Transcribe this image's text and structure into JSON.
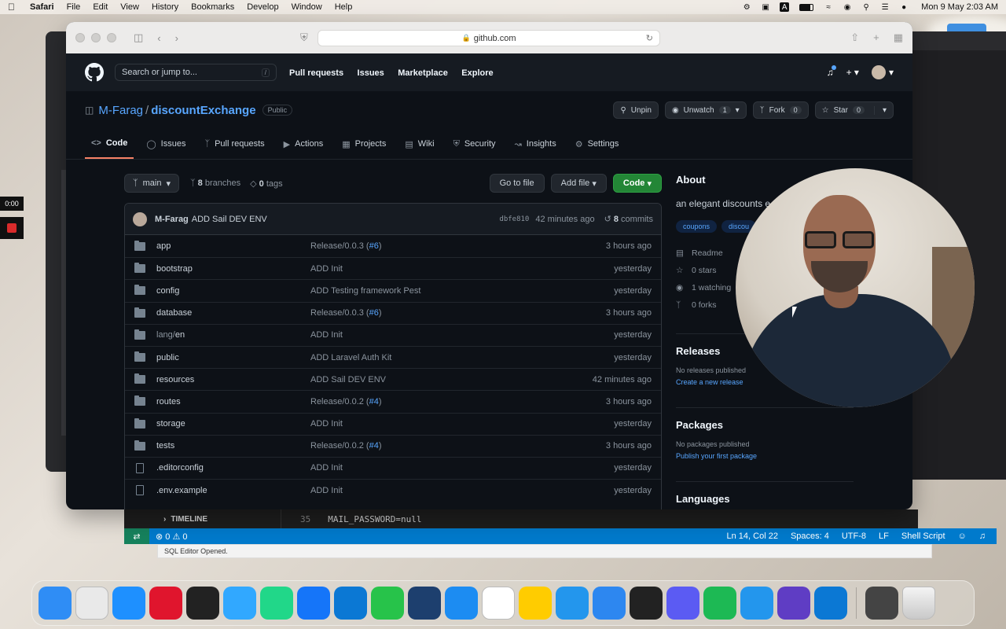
{
  "menubar": {
    "app": "Safari",
    "items": [
      "File",
      "Edit",
      "View",
      "History",
      "Bookmarks",
      "Develop",
      "Window",
      "Help"
    ],
    "datetime": "Mon 9 May  2:03 AM"
  },
  "recorder": {
    "time": "0:00"
  },
  "browser": {
    "url": "github.com"
  },
  "github": {
    "search_placeholder": "Search or jump to...",
    "search_shortcut": "/",
    "nav": [
      "Pull requests",
      "Issues",
      "Marketplace",
      "Explore"
    ],
    "repo": {
      "owner": "M-Farag",
      "separator": "/",
      "name": "discountExchange",
      "visibility": "Public",
      "actions": {
        "unpin": "Unpin",
        "unwatch": "Unwatch",
        "unwatch_count": "1",
        "fork": "Fork",
        "fork_count": "0",
        "star": "Star",
        "star_count": "0"
      },
      "tabs": [
        "Code",
        "Issues",
        "Pull requests",
        "Actions",
        "Projects",
        "Wiki",
        "Security",
        "Insights",
        "Settings"
      ]
    },
    "branch": {
      "name": "main",
      "branches_count": "8",
      "branches_label": "branches",
      "tags_count": "0",
      "tags_label": "tags",
      "go_to_file": "Go to file",
      "add_file": "Add file",
      "code": "Code"
    },
    "latest_commit": {
      "author": "M-Farag",
      "message": "ADD Sail DEV ENV",
      "sha": "dbfe810",
      "time": "42 minutes ago",
      "commits_count": "8",
      "commits_label": "commits"
    },
    "files": [
      {
        "name": "app",
        "type": "dir",
        "msg": "Release/0.0.3 (",
        "pr": "#6",
        "msg_end": ")",
        "time": "3 hours ago"
      },
      {
        "name": "bootstrap",
        "type": "dir",
        "msg": "ADD Init",
        "pr": "",
        "msg_end": "",
        "time": "yesterday"
      },
      {
        "name": "config",
        "type": "dir",
        "msg": "ADD Testing framework Pest",
        "pr": "",
        "msg_end": "",
        "time": "yesterday"
      },
      {
        "name": "database",
        "type": "dir",
        "msg": "Release/0.0.3 (",
        "pr": "#6",
        "msg_end": ")",
        "time": "3 hours ago"
      },
      {
        "name_dim": "lang/",
        "name": "en",
        "type": "dir",
        "msg": "ADD Init",
        "pr": "",
        "msg_end": "",
        "time": "yesterday"
      },
      {
        "name": "public",
        "type": "dir",
        "msg": "ADD Laravel Auth Kit",
        "pr": "",
        "msg_end": "",
        "time": "yesterday"
      },
      {
        "name": "resources",
        "type": "dir",
        "msg": "ADD Sail DEV ENV",
        "pr": "",
        "msg_end": "",
        "time": "42 minutes ago"
      },
      {
        "name": "routes",
        "type": "dir",
        "msg": "Release/0.0.2 (",
        "pr": "#4",
        "msg_end": ")",
        "time": "3 hours ago"
      },
      {
        "name": "storage",
        "type": "dir",
        "msg": "ADD Init",
        "pr": "",
        "msg_end": "",
        "time": "yesterday"
      },
      {
        "name": "tests",
        "type": "dir",
        "msg": "Release/0.0.2 (",
        "pr": "#4",
        "msg_end": ")",
        "time": "3 hours ago"
      },
      {
        "name": ".editorconfig",
        "type": "file",
        "msg": "ADD Init",
        "pr": "",
        "msg_end": "",
        "time": "yesterday"
      },
      {
        "name": ".env.example",
        "type": "file",
        "msg": "ADD Init",
        "pr": "",
        "msg_end": "",
        "time": "yesterday"
      }
    ],
    "about": {
      "heading": "About",
      "description": "an elegant discounts e",
      "topics": [
        "coupons",
        "discou"
      ],
      "stats": [
        {
          "icon": "book-icon",
          "label": "Readme"
        },
        {
          "icon": "star-icon",
          "label": "0 stars"
        },
        {
          "icon": "eye-icon",
          "label": "1 watching"
        },
        {
          "icon": "fork-icon",
          "label": "0 forks"
        }
      ],
      "releases": {
        "heading": "Releases",
        "sub": "No releases published",
        "link": "Create a new release"
      },
      "packages": {
        "heading": "Packages",
        "sub": "No packages published",
        "link": "Publish your first package"
      },
      "languages": {
        "heading": "Languages"
      }
    }
  },
  "vscode": {
    "timeline": "TIMELINE",
    "line_number": "35",
    "code_line": "MAIL_PASSWORD=null",
    "errors": "0",
    "warnings": "0",
    "position": "Ln 14, Col 22",
    "spaces": "Spaces: 4",
    "encoding": "UTF-8",
    "eol": "LF",
    "language": "Shell Script",
    "notification": "SQL Editor Opened."
  },
  "dock": {
    "colors": [
      "#2f8df5",
      "#e9e9e9",
      "#1e90ff",
      "#e0152d",
      "#222222",
      "#31a8ff",
      "#21d789",
      "#1575f9",
      "#0b78d4",
      "#27c34a",
      "#1d3f6e",
      "#1c8cf2",
      "#ffffff",
      "#ffcc00",
      "#2396ed",
      "#2d87f0",
      "#222222",
      "#5b5bf3",
      "#1db954",
      "#2396ed",
      "#5f3dc4",
      "#0b78d4",
      "#444444",
      "#d8d8d8"
    ]
  }
}
